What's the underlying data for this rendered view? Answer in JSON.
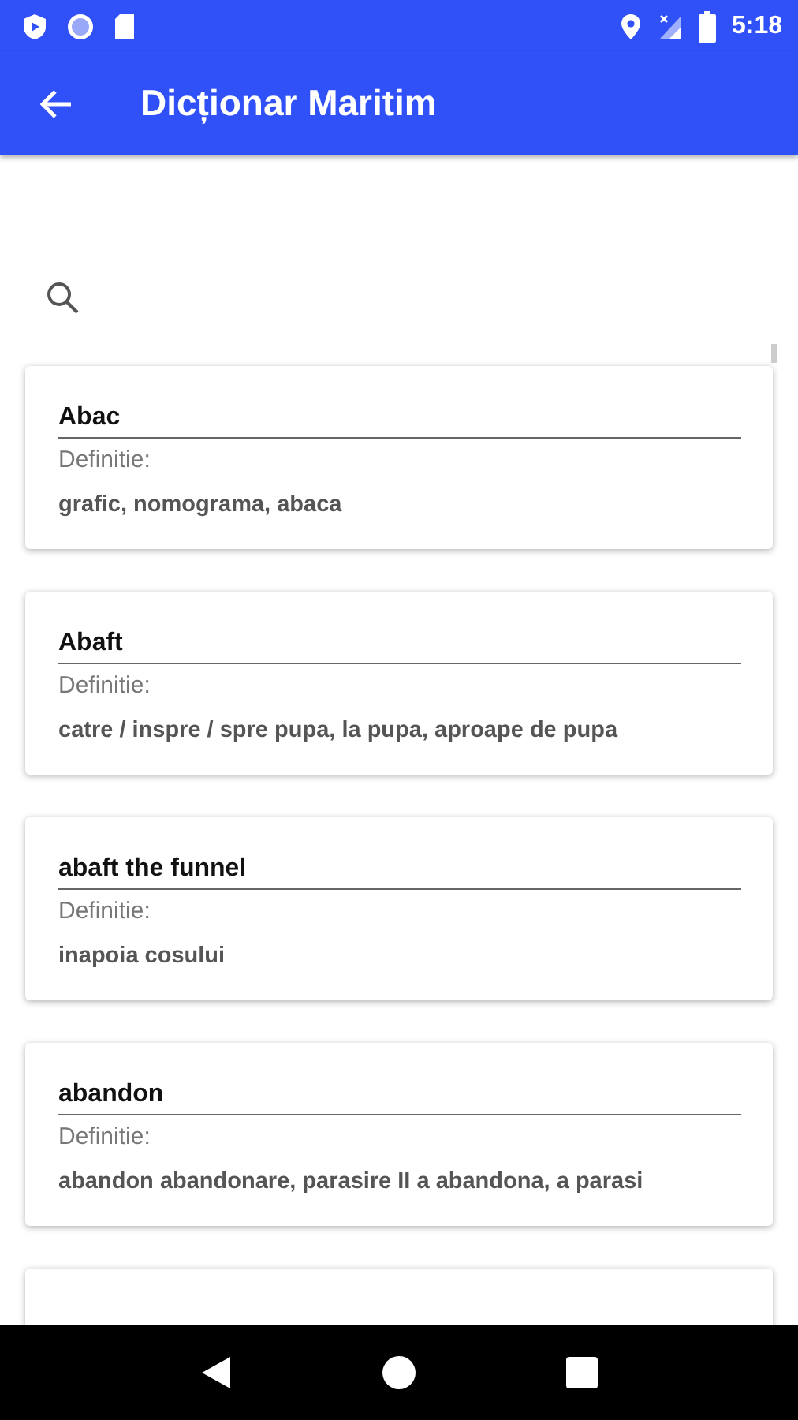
{
  "status_bar": {
    "time": "5:18"
  },
  "app_bar": {
    "title": "Dicționar Maritim"
  },
  "entries": [
    {
      "term": "Abac",
      "label": "Definitie:",
      "definition": "grafic, nomograma, abaca"
    },
    {
      "term": "Abaft",
      "label": "Definitie:",
      "definition": "catre / inspre / spre pupa, la pupa, aproape de pupa"
    },
    {
      "term": "abaft the funnel",
      "label": "Definitie:",
      "definition": "inapoia cosului"
    },
    {
      "term": "abandon",
      "label": "Definitie:",
      "definition": "abandon abandonare, parasire II a abandona, a parasi"
    }
  ]
}
